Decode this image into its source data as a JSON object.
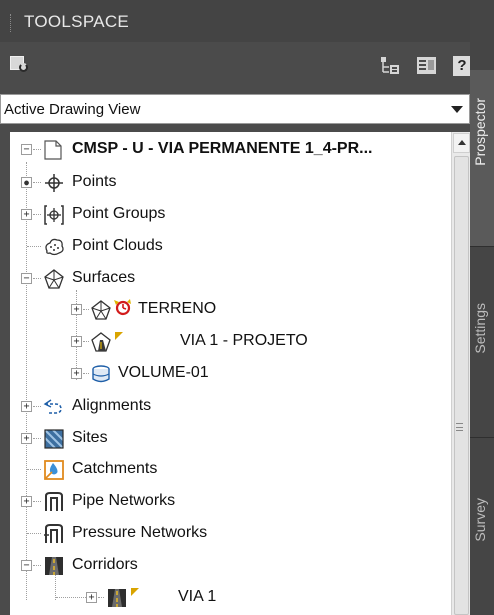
{
  "palette": {
    "title_bg": "#444444",
    "panel_bg": "#4b4b4b",
    "tree_bg": "#ffffff",
    "text": "#111111",
    "title_text": "#e8e8e8"
  },
  "title": "TOOLSPACE",
  "toolbar": {
    "help_label": "?"
  },
  "dropdown": {
    "selected": "Active Drawing View"
  },
  "tree": {
    "root": "CMSP - U - VIA PERMANENTE 1_4-PR...",
    "items": [
      {
        "label": "Points"
      },
      {
        "label": "Point Groups"
      },
      {
        "label": "Point Clouds"
      },
      {
        "label": "Surfaces"
      },
      {
        "label": "TERRENO"
      },
      {
        "label": "VIA 1 - PROJETO"
      },
      {
        "label": "VOLUME-01"
      },
      {
        "label": "Alignments"
      },
      {
        "label": "Sites"
      },
      {
        "label": "Catchments"
      },
      {
        "label": "Pipe Networks"
      },
      {
        "label": "Pressure Networks"
      },
      {
        "label": "Corridors"
      },
      {
        "label": "VIA 1"
      }
    ]
  },
  "side_tabs": [
    {
      "label": "Prospector",
      "active": true
    },
    {
      "label": "Settings",
      "active": false
    },
    {
      "label": "Survey",
      "active": false
    }
  ]
}
